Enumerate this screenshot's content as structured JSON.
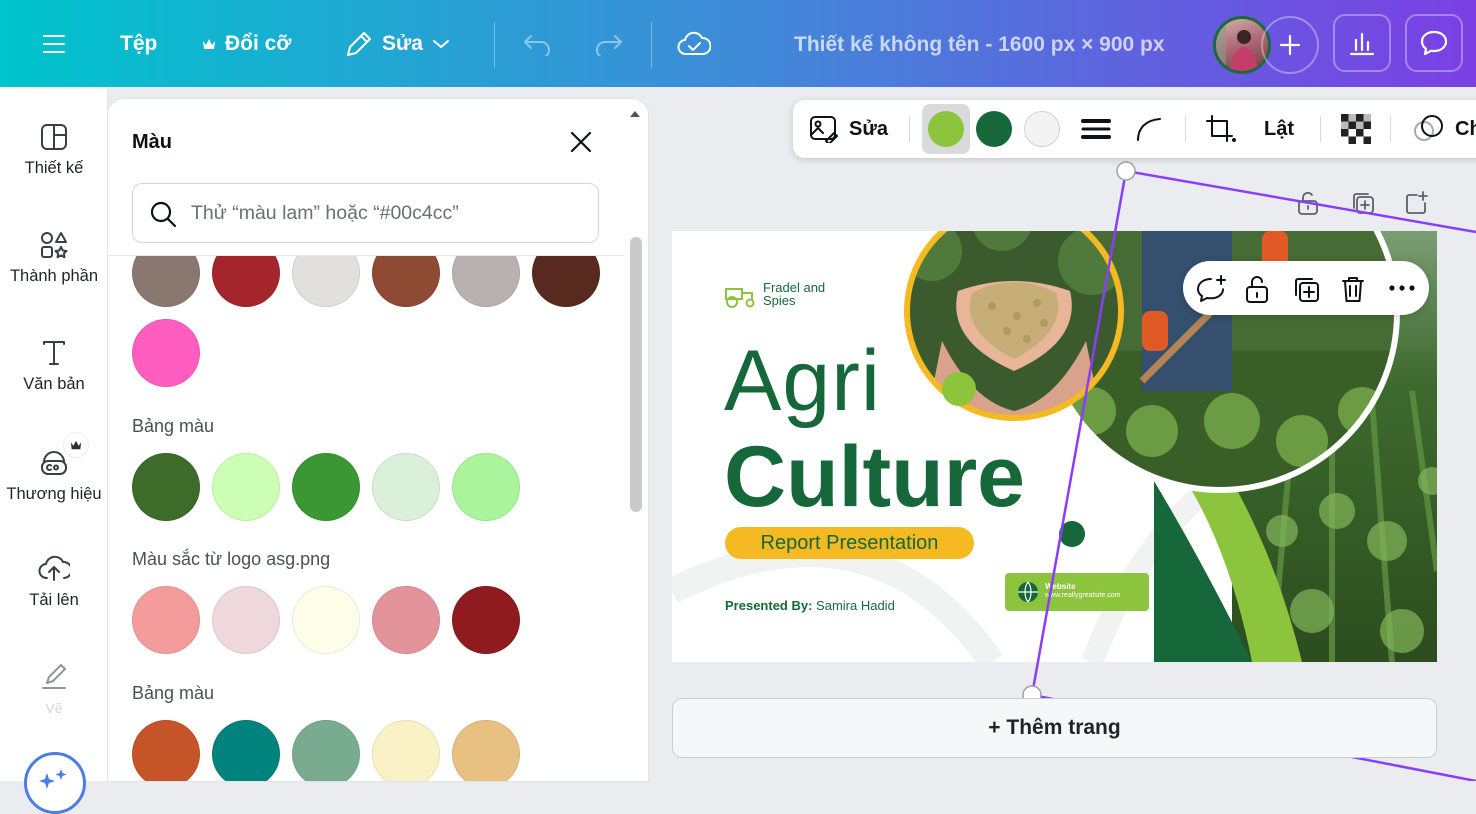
{
  "topbar": {
    "file": "Tệp",
    "resize": "Đổi cỡ",
    "edit": "Sửa",
    "title": "Thiết kế không tên - 1600 px × 900 px",
    "icons": [
      "menu-icon",
      "crown-icon",
      "pencil-icon",
      "chevron-down-icon",
      "undo-icon",
      "redo-icon",
      "cloud-check-icon",
      "plus-icon",
      "bar-chart-icon",
      "comment-icon"
    ]
  },
  "rail": {
    "items": [
      {
        "label": "Thiết kế",
        "icon": "layout-icon"
      },
      {
        "label": "Thành phần",
        "icon": "shapes-icon"
      },
      {
        "label": "Văn bản",
        "icon": "text-icon"
      },
      {
        "label": "Thương hiệu",
        "icon": "brand-icon"
      },
      {
        "label": "Tải lên",
        "icon": "cloud-upload-icon"
      },
      {
        "label": "Vẽ",
        "icon": "draw-icon"
      }
    ]
  },
  "panel": {
    "title": "Màu",
    "search_placeholder": "Thử “màu lam” hoặc “#00c4cc”",
    "recent_colors": [
      "#8a7870",
      "#a5252d",
      "#e2e0dd",
      "#8e4a33",
      "#b8b1af",
      "#582a1f",
      "#ff5ec0"
    ],
    "sections": [
      {
        "label": "Bảng màu",
        "colors": [
          "#3d6b2a",
          "#ccffb5",
          "#3a9733",
          "#dbf0d8",
          "#aaf59c"
        ]
      },
      {
        "label": "Màu sắc từ logo asg.png",
        "colors": [
          "#f49b9b",
          "#efd8dc",
          "#fdfde9",
          "#e3949a",
          "#8f1b1f"
        ]
      },
      {
        "label": "Bảng màu",
        "colors": [
          "#c65429",
          "#00837d",
          "#78ab90",
          "#fbf1c6",
          "#e8c182"
        ]
      }
    ]
  },
  "toolbar": {
    "edit": "Sửa",
    "flip": "Lật",
    "more_label": "Ch",
    "colors": [
      "#8cc43e",
      "#16683a",
      "#f3f3f3"
    ]
  },
  "slide": {
    "brand": "Fradel and Spies",
    "title1": "Agri",
    "title2": "Culture",
    "pill": "Report Presentation",
    "presented_label": "Presented By:",
    "presenter": "Samira Hadid",
    "website_label": "Website",
    "website_url": "www.reallygreatsite.com",
    "colors": {
      "dark_green": "#16683a",
      "light_green": "#8cc43e",
      "yellow": "#f5b922"
    }
  },
  "add_page": "+ Thêm trang"
}
